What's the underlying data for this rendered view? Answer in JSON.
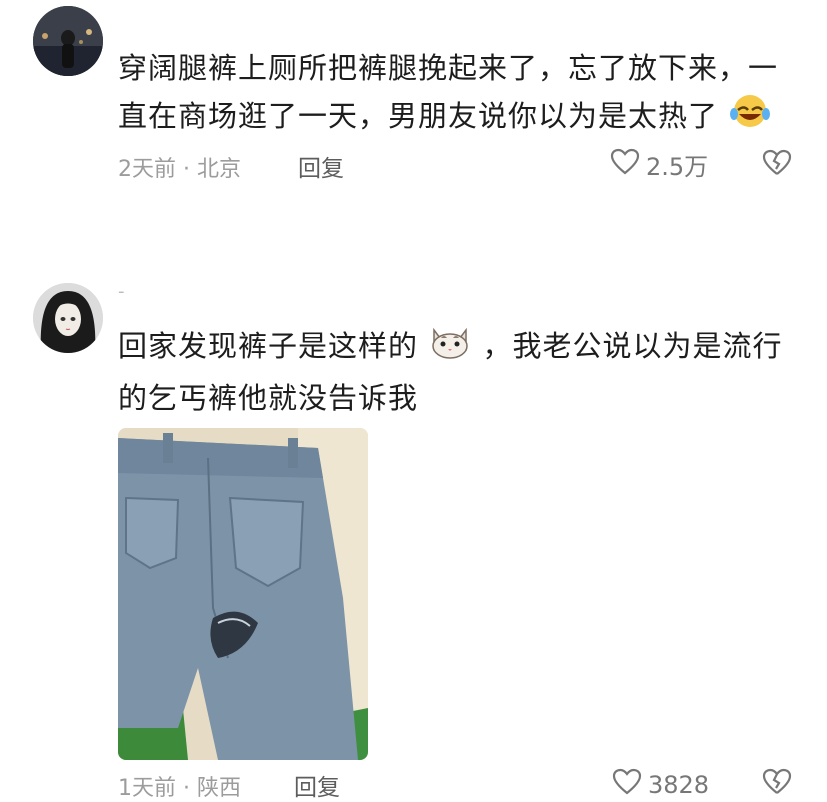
{
  "comments": [
    {
      "text_line1": "穿阔腿裤上厕所把裤腿挽起来了，忘了放下来，一",
      "text_line2": "直在商场逛了一天，男朋友说你以为是太热了",
      "emoji": "rolling-laughing-emoji",
      "time_location": "2天前 · 北京",
      "reply_label": "回复",
      "like_count": "2.5万"
    },
    {
      "text_line1a": "回家发现裤子是这样的",
      "text_line1b": "，我老公说以为是流行",
      "text_line2": "的乞丐裤他就没告诉我",
      "emoji": "cat-face-emoji",
      "image": "torn-jeans-photo",
      "time_location": "1天前 · 陕西",
      "reply_label": "回复",
      "like_count": "3828"
    }
  ],
  "separator": "-",
  "icons": [
    "heart-icon",
    "broken-heart-icon"
  ]
}
